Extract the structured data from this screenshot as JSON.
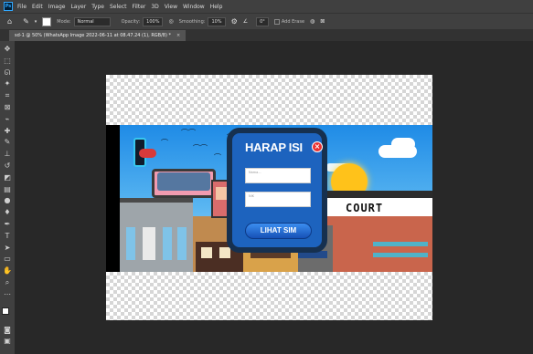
{
  "app": {
    "logo_text": "Ps"
  },
  "menu": [
    "File",
    "Edit",
    "Image",
    "Layer",
    "Type",
    "Select",
    "Filter",
    "3D",
    "View",
    "Window",
    "Help"
  ],
  "options": {
    "mode_label": "Mode:",
    "mode_value": "Normal",
    "opacity_label": "Opacity:",
    "opacity_value": "100%",
    "smoothing_label": "Smoothing:",
    "smoothing_value": "10%",
    "angle_value": "0°",
    "airbrush_label": "Add Erase"
  },
  "document": {
    "tab_title": "sd-1 @ 50% (WhatsApp Image 2022-06-11 at 08.47.24 (1), RGB/8) *",
    "close_glyph": "×"
  },
  "tools": [
    "move-tool",
    "marquee-tool",
    "lasso-tool",
    "magic-wand-tool",
    "crop-tool",
    "frame-tool",
    "eyedropper-tool",
    "healing-brush-tool",
    "brush-tool",
    "clone-stamp-tool",
    "history-brush-tool",
    "eraser-tool",
    "gradient-tool",
    "blur-tool",
    "dodge-tool",
    "pen-tool",
    "type-tool",
    "path-selection-tool",
    "rectangle-tool",
    "hand-tool",
    "zoom-tool",
    "edit-toolbar"
  ],
  "colors": {
    "foreground": "#ffffff",
    "background": "#000000",
    "accent": "#31a8ff"
  },
  "artwork": {
    "sign_text": "COURT",
    "popup": {
      "title": "HARAP ISI",
      "close_glyph": "×",
      "field1_placeholder": "Nama...",
      "field2_placeholder": "NIK",
      "button_label": "LIHAT SIM"
    }
  }
}
